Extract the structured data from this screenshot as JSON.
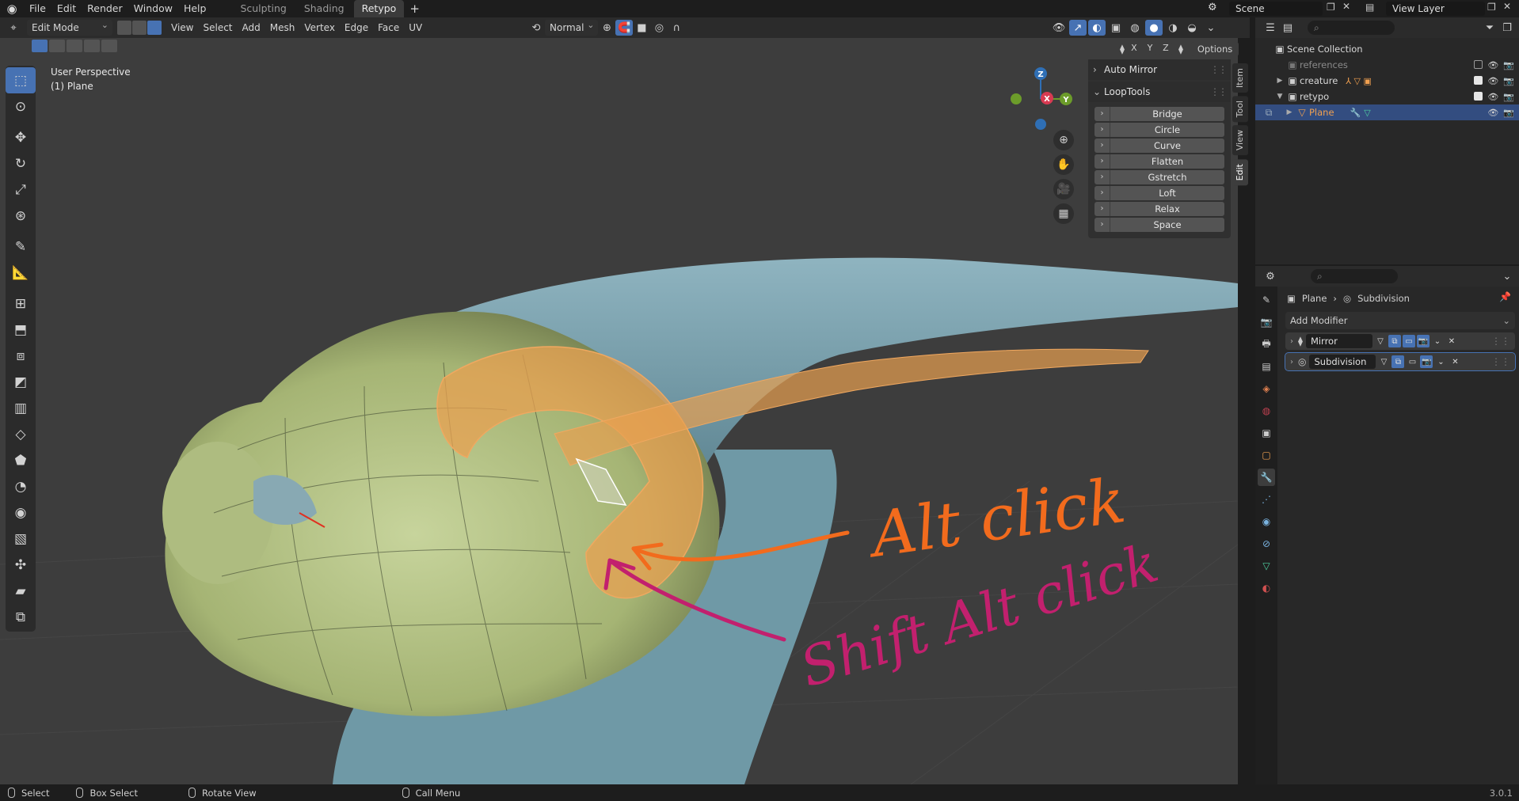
{
  "topbar": {
    "menus": [
      "File",
      "Edit",
      "Render",
      "Window",
      "Help"
    ],
    "workspaces": [
      "Sculpting",
      "Shading",
      "Retypo"
    ],
    "active_workspace": "Retypo",
    "scene": "Scene",
    "view_layer": "View Layer"
  },
  "viewport_header": {
    "mode": "Edit Mode",
    "menus": [
      "View",
      "Select",
      "Add",
      "Mesh",
      "Vertex",
      "Edge",
      "Face",
      "UV"
    ],
    "orientation": "Normal",
    "axes": [
      "X",
      "Y",
      "Z"
    ],
    "options_label": "Options"
  },
  "viewport": {
    "view_name": "User Perspective",
    "object_name": "(1) Plane",
    "annotation_1": "Alt click",
    "annotation_2": "Shift Alt click",
    "annotation_1_color": "#f26b1d",
    "annotation_2_color": "#c2206e",
    "gizmo_axes": {
      "z": "Z",
      "x": "X",
      "y": "Y"
    }
  },
  "npanel": {
    "auto_mirror": "Auto Mirror",
    "looptools": "LoopTools",
    "buttons": [
      "Bridge",
      "Circle",
      "Curve",
      "Flatten",
      "Gstretch",
      "Loft",
      "Relax",
      "Space"
    ],
    "tabs": [
      "Item",
      "Tool",
      "View",
      "Edit"
    ],
    "active_tab": "Edit"
  },
  "outliner": {
    "search_placeholder": "",
    "root": "Scene Collection",
    "rows": [
      {
        "name": "references",
        "dim": true
      },
      {
        "name": "creature"
      },
      {
        "name": "retypo"
      },
      {
        "name": "Plane",
        "selected": true
      }
    ]
  },
  "properties": {
    "breadcrumb_object": "Plane",
    "breadcrumb_modifier": "Subdivision",
    "add_modifier": "Add Modifier",
    "modifiers": [
      "Mirror",
      "Subdivision"
    ]
  },
  "statusbar": {
    "items": [
      "Select",
      "Box Select",
      "Rotate View",
      "Call Menu"
    ],
    "version": "3.0.1"
  }
}
